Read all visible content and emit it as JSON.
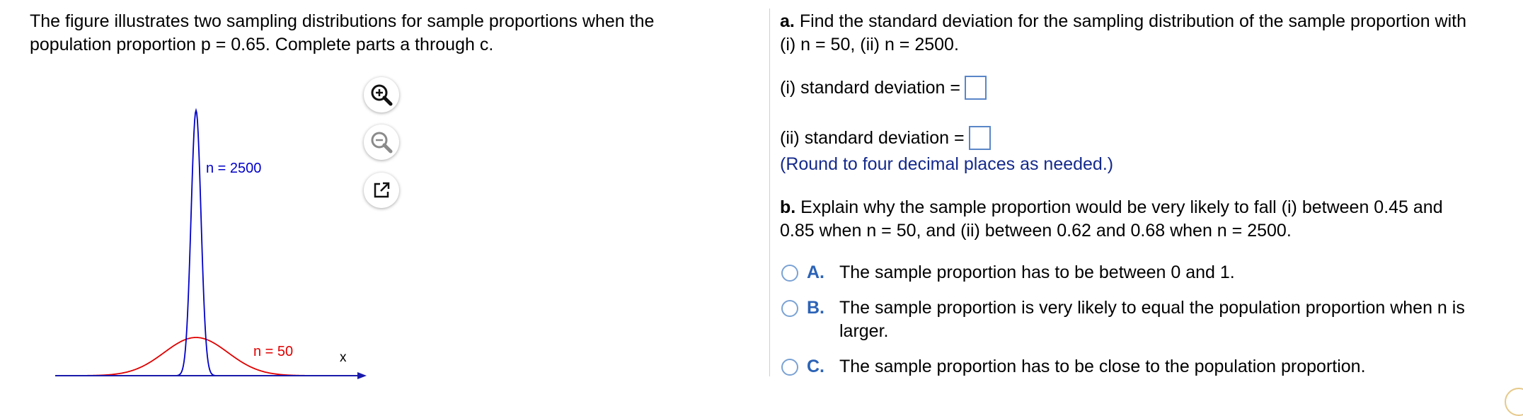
{
  "intro": {
    "line1": "The figure illustrates two sampling distributions for sample proportions when the",
    "line2": "population proportion p = 0.65. Complete parts a through c."
  },
  "figure": {
    "label_large_n": "n = 2500",
    "label_small_n": "n = 50",
    "axis_label": "x",
    "colors": {
      "large_n": "#0000c8",
      "small_n": "#e00000",
      "axis": "#1a1aaa"
    },
    "tools": [
      "zoom-in-icon",
      "zoom-out-icon",
      "open-external-icon"
    ]
  },
  "part_a": {
    "prefix": "a.",
    "prompt_line1": "Find the standard deviation for the sampling distribution of the sample proportion with",
    "prompt_line2": "(i) n = 50, (ii) n = 2500.",
    "answer_i_label": "(i) standard deviation =",
    "answer_ii_label": "(ii) standard deviation =",
    "answer_i_value": "",
    "answer_ii_value": "",
    "note": "(Round to four decimal places as needed.)"
  },
  "part_b": {
    "prefix": "b.",
    "prompt_line1": "Explain why the sample proportion would be very likely to fall (i) between 0.45 and",
    "prompt_line2": "0.85 when n = 50, and (ii) between 0.62 and 0.68 when n = 2500.",
    "options": [
      {
        "letter": "A.",
        "text": "The sample proportion has to be between 0 and 1."
      },
      {
        "letter": "B.",
        "text_line1": "The sample proportion is very likely to equal the population proportion when n is",
        "text_line2": "larger."
      },
      {
        "letter": "C.",
        "text": "The sample proportion has to be close to the population proportion."
      }
    ]
  }
}
